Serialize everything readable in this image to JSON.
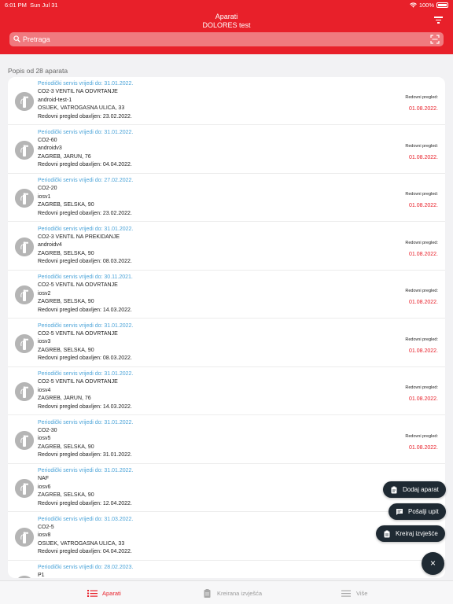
{
  "status": {
    "time": "6:01 PM",
    "date": "Sun Jul 31",
    "battery": "100%"
  },
  "header": {
    "title": "Aparati",
    "subtitle": "DOLORES test"
  },
  "search": {
    "placeholder": "Pretraga",
    "value": ""
  },
  "list": {
    "title": "Popis od 28 aparata",
    "items": [
      {
        "service": "Periodički servis vrijedi do: 31.01.2022.",
        "name": "CO2-3 VENTIL NA ODVRTANJE",
        "code": "android-test-1",
        "address": "OSIJEK, VATROGASNA ULICA, 33",
        "done": "Redovni pregled obavljen: 23.02.2022.",
        "next_label": "Redovni pregled:",
        "next_date": "01.08.2022."
      },
      {
        "service": "Periodički servis vrijedi do: 31.01.2022.",
        "name": "CO2-60",
        "code": "androidv3",
        "address": "ZAGREB, JARUN, 76",
        "done": "Redovni pregled obavljen: 04.04.2022.",
        "next_label": "Redovni pregled:",
        "next_date": "01.08.2022."
      },
      {
        "service": "Periodički servis vrijedi do: 27.02.2022.",
        "name": "CO2-20",
        "code": "iosv1",
        "address": "ZAGREB, SELSKA, 90",
        "done": "Redovni pregled obavljen: 23.02.2022.",
        "next_label": "Redovni pregled:",
        "next_date": "01.08.2022."
      },
      {
        "service": "Periodički servis vrijedi do: 31.01.2022.",
        "name": "CO2-3 VENTIL NA PREKIDANJE",
        "code": "androidv4",
        "address": "ZAGREB, SELSKA, 90",
        "done": "Redovni pregled obavljen: 08.03.2022.",
        "next_label": "Redovni pregled:",
        "next_date": "01.08.2022."
      },
      {
        "service": "Periodički servis vrijedi do: 30.11.2021.",
        "name": "CO2-5 VENTIL NA ODVRTANJE",
        "code": "iosv2",
        "address": "ZAGREB, SELSKA, 90",
        "done": "Redovni pregled obavljen: 14.03.2022.",
        "next_label": "Redovni pregled:",
        "next_date": "01.08.2022."
      },
      {
        "service": "Periodički servis vrijedi do: 31.01.2022.",
        "name": "CO2-5 VENTIL NA ODVRTANJE",
        "code": "iosv3",
        "address": "ZAGREB, SELSKA, 90",
        "done": "Redovni pregled obavljen: 08.03.2022.",
        "next_label": "Redovni pregled:",
        "next_date": "01.08.2022."
      },
      {
        "service": "Periodički servis vrijedi do: 31.01.2022.",
        "name": "CO2-5 VENTIL NA ODVRTANJE",
        "code": "iosv4",
        "address": "ZAGREB, JARUN, 76",
        "done": "Redovni pregled obavljen: 14.03.2022.",
        "next_label": "Redovni pregled:",
        "next_date": "01.08.2022."
      },
      {
        "service": "Periodički servis vrijedi do: 31.01.2022.",
        "name": "CO2-30",
        "code": "iosv5",
        "address": "ZAGREB, SELSKA, 90",
        "done": "Redovni pregled obavljen: 31.01.2022.",
        "next_label": "Redovni pregled:",
        "next_date": "01.08.2022."
      },
      {
        "service": "Periodički servis vrijedi do: 31.01.2022.",
        "name": "NAF",
        "code": "iosv6",
        "address": "ZAGREB, SELSKA, 90",
        "done": "Redovni pregled obavljen: 12.04.2022.",
        "next_label": "",
        "next_date": ""
      },
      {
        "service": "Periodički servis vrijedi do: 31.03.2022.",
        "name": "CO2-5",
        "code": "iosv8",
        "address": "OSIJEK, VATROGASNA ULICA, 33",
        "done": "Redovni pregled obavljen: 04.04.2022.",
        "next_label": "",
        "next_date": ""
      },
      {
        "service": "Periodički servis vrijedi do: 28.02.2023.",
        "name": "P1",
        "code": "",
        "address": "",
        "done": "",
        "next_label": "",
        "next_date": ""
      }
    ]
  },
  "fab": {
    "add": "Dodaj aparat",
    "send": "Pošalji upit",
    "report": "Kreiraj izvješće",
    "close": "×"
  },
  "tabs": {
    "devices": "Aparati",
    "reports": "Kreirana izvješća",
    "more": "Više"
  },
  "colors": {
    "accent": "#e8202a",
    "link": "#4aa3d8",
    "dark": "#1f2a33"
  }
}
